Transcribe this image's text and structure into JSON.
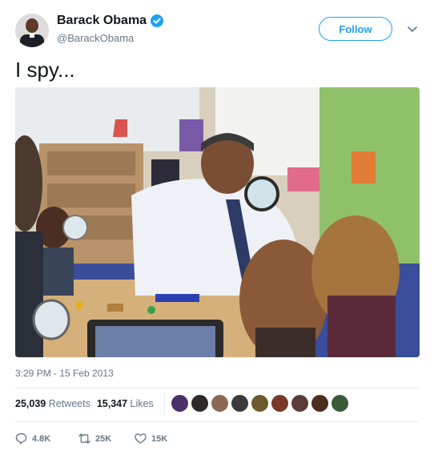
{
  "user": {
    "name": "Barack Obama",
    "handle": "@BarackObama"
  },
  "follow_label": "Follow",
  "tweet": {
    "text": "I spy..."
  },
  "timestamp": "3:29 PM - 15 Feb 2013",
  "stats": {
    "retweets_count": "25,039",
    "retweets_label": "Retweets",
    "likes_count": "15,347",
    "likes_label": "Likes"
  },
  "liker_colors": [
    "#4a2f6b",
    "#2f2a2a",
    "#8a6a55",
    "#3b3b3b",
    "#6b5a2c",
    "#7a3a2a",
    "#5a3d38",
    "#4b2e20",
    "#3d5a3a"
  ],
  "actions": {
    "replies": "4.8K",
    "retweets": "25K",
    "likes": "15K"
  },
  "colors": {
    "accent": "#1da1f2",
    "secondary_text": "#657786",
    "divider": "#e6ecf0"
  }
}
